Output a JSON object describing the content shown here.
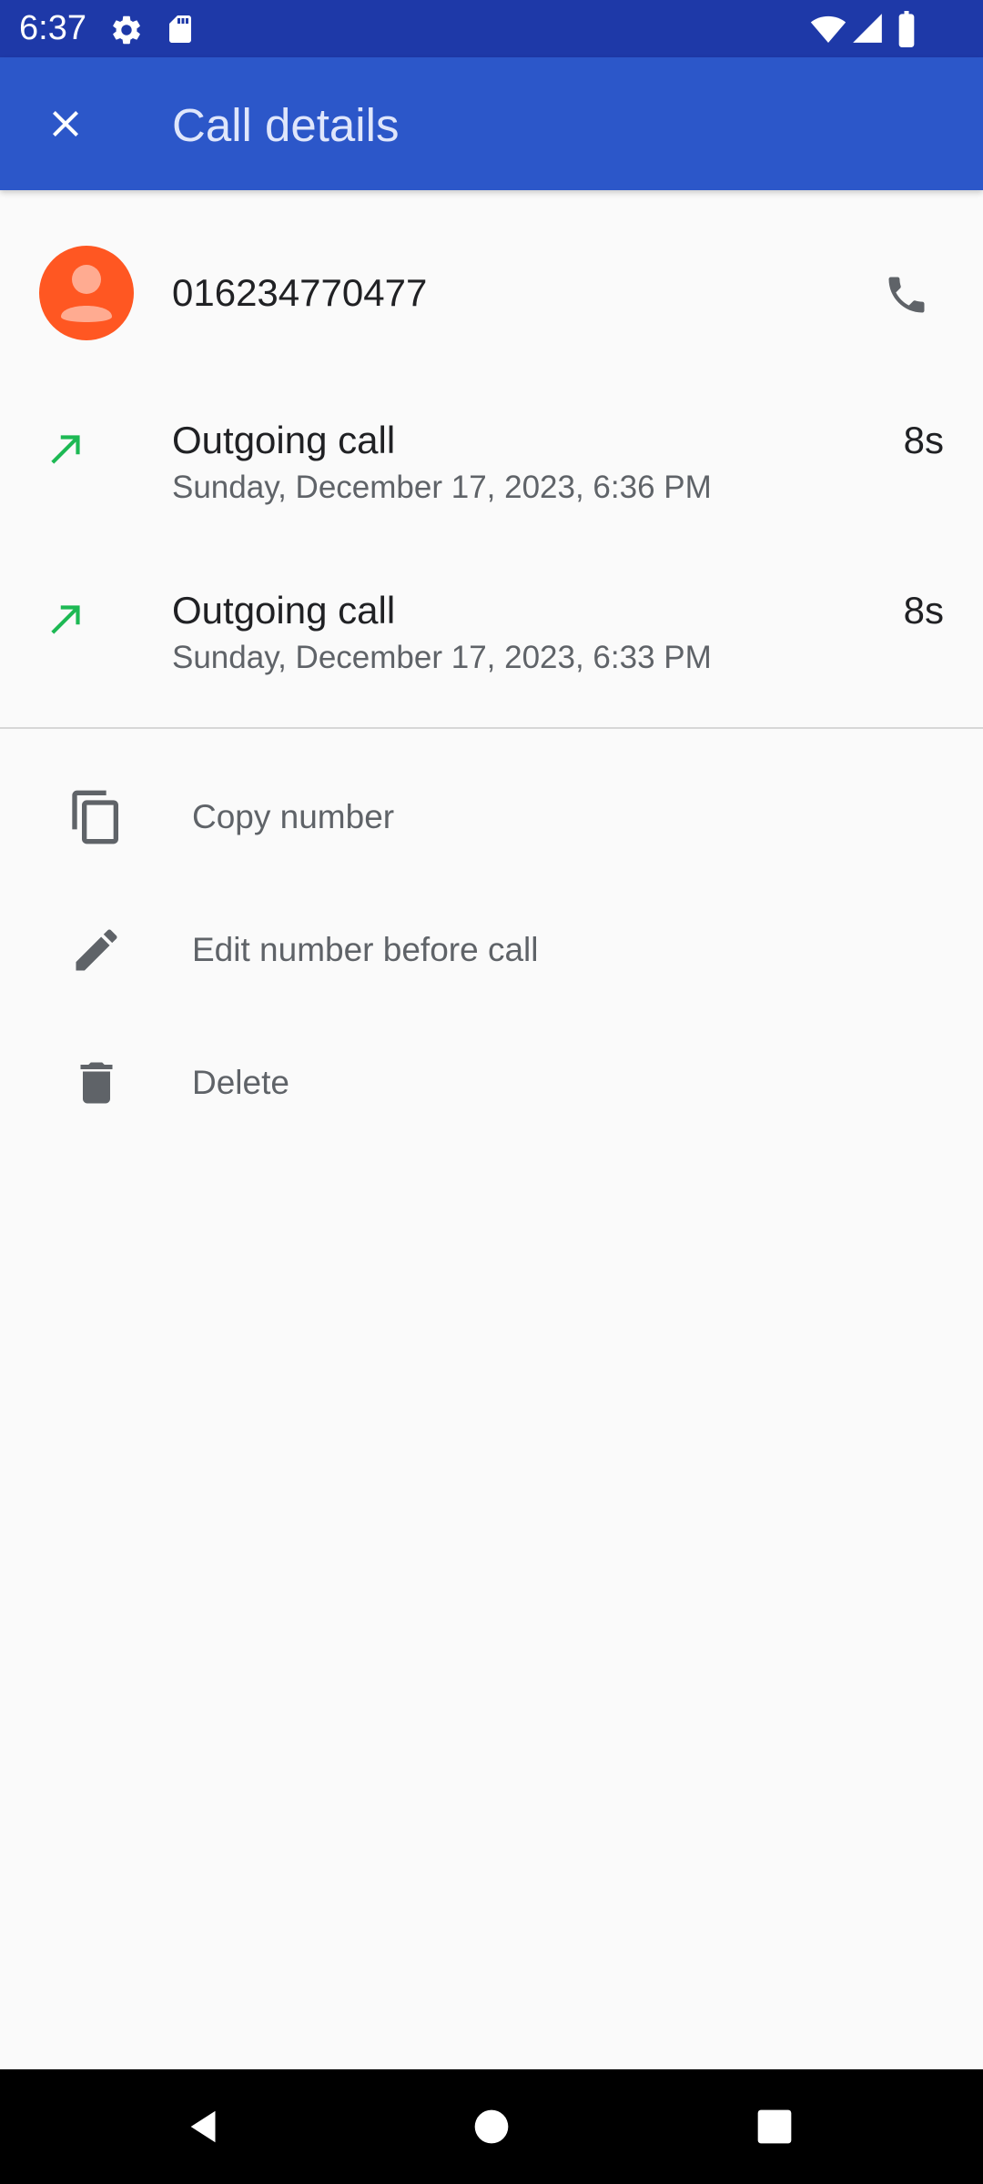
{
  "status_bar": {
    "time": "6:37",
    "icons": [
      "gear-icon",
      "sd-card-icon",
      "wifi-icon",
      "signal-icon",
      "battery-icon"
    ]
  },
  "app_bar": {
    "close_icon": "close-icon",
    "title": "Call details"
  },
  "contact": {
    "avatar_icon": "person-icon",
    "avatar_color": "#ff5722",
    "number": "016234770477",
    "call_icon": "phone-icon"
  },
  "calls": [
    {
      "type": "Outgoing call",
      "date": "Sunday, December 17, 2023, 6:36 PM",
      "duration": "8s",
      "icon": "outgoing-arrow-icon"
    },
    {
      "type": "Outgoing call",
      "date": "Sunday, December 17, 2023, 6:33 PM",
      "duration": "8s",
      "icon": "outgoing-arrow-icon"
    }
  ],
  "actions": [
    {
      "label": "Copy number",
      "icon": "copy-icon"
    },
    {
      "label": "Edit number before call",
      "icon": "pencil-icon"
    },
    {
      "label": "Delete",
      "icon": "trash-icon"
    }
  ],
  "nav_bar": {
    "back_icon": "back-icon",
    "home_icon": "home-icon",
    "recents_icon": "recents-icon"
  },
  "colors": {
    "status_bar": "#1e39a8",
    "app_bar": "#2c57c9",
    "outgoing_arrow": "#1db954",
    "background": "#fafafa"
  }
}
